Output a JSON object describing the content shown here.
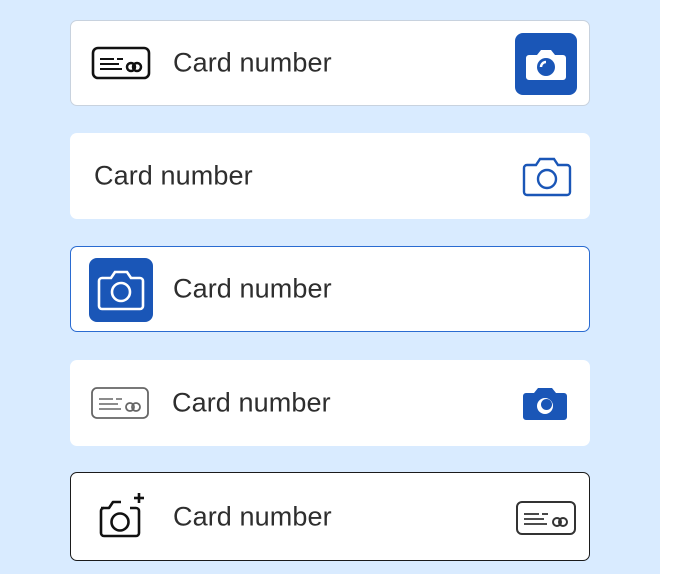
{
  "colors": {
    "background": "#d9ebff",
    "field": "#ffffff",
    "accent": "#1a56b7",
    "focus_border": "#2a6bd1",
    "text": "#2e2e2e"
  },
  "fields": [
    {
      "label": "Card number",
      "leading_icon": "credit-card-icon",
      "trailing_icon": "camera-icon",
      "trailing_style": "filled-square-blue"
    },
    {
      "label": "Card number",
      "leading_icon": null,
      "trailing_icon": "camera-outline-icon",
      "trailing_style": "outline-blue"
    },
    {
      "label": "Card number",
      "leading_icon": "camera-icon",
      "leading_style": "filled-square-blue",
      "trailing_icon": null
    },
    {
      "label": "Card number",
      "leading_icon": "credit-card-icon",
      "leading_style": "outline-gray",
      "trailing_icon": "camera-icon",
      "trailing_style": "filled-blue"
    },
    {
      "label": "Card number",
      "leading_icon": "add-photo-icon",
      "trailing_icon": "credit-card-icon",
      "trailing_style": "outline-dark"
    }
  ]
}
